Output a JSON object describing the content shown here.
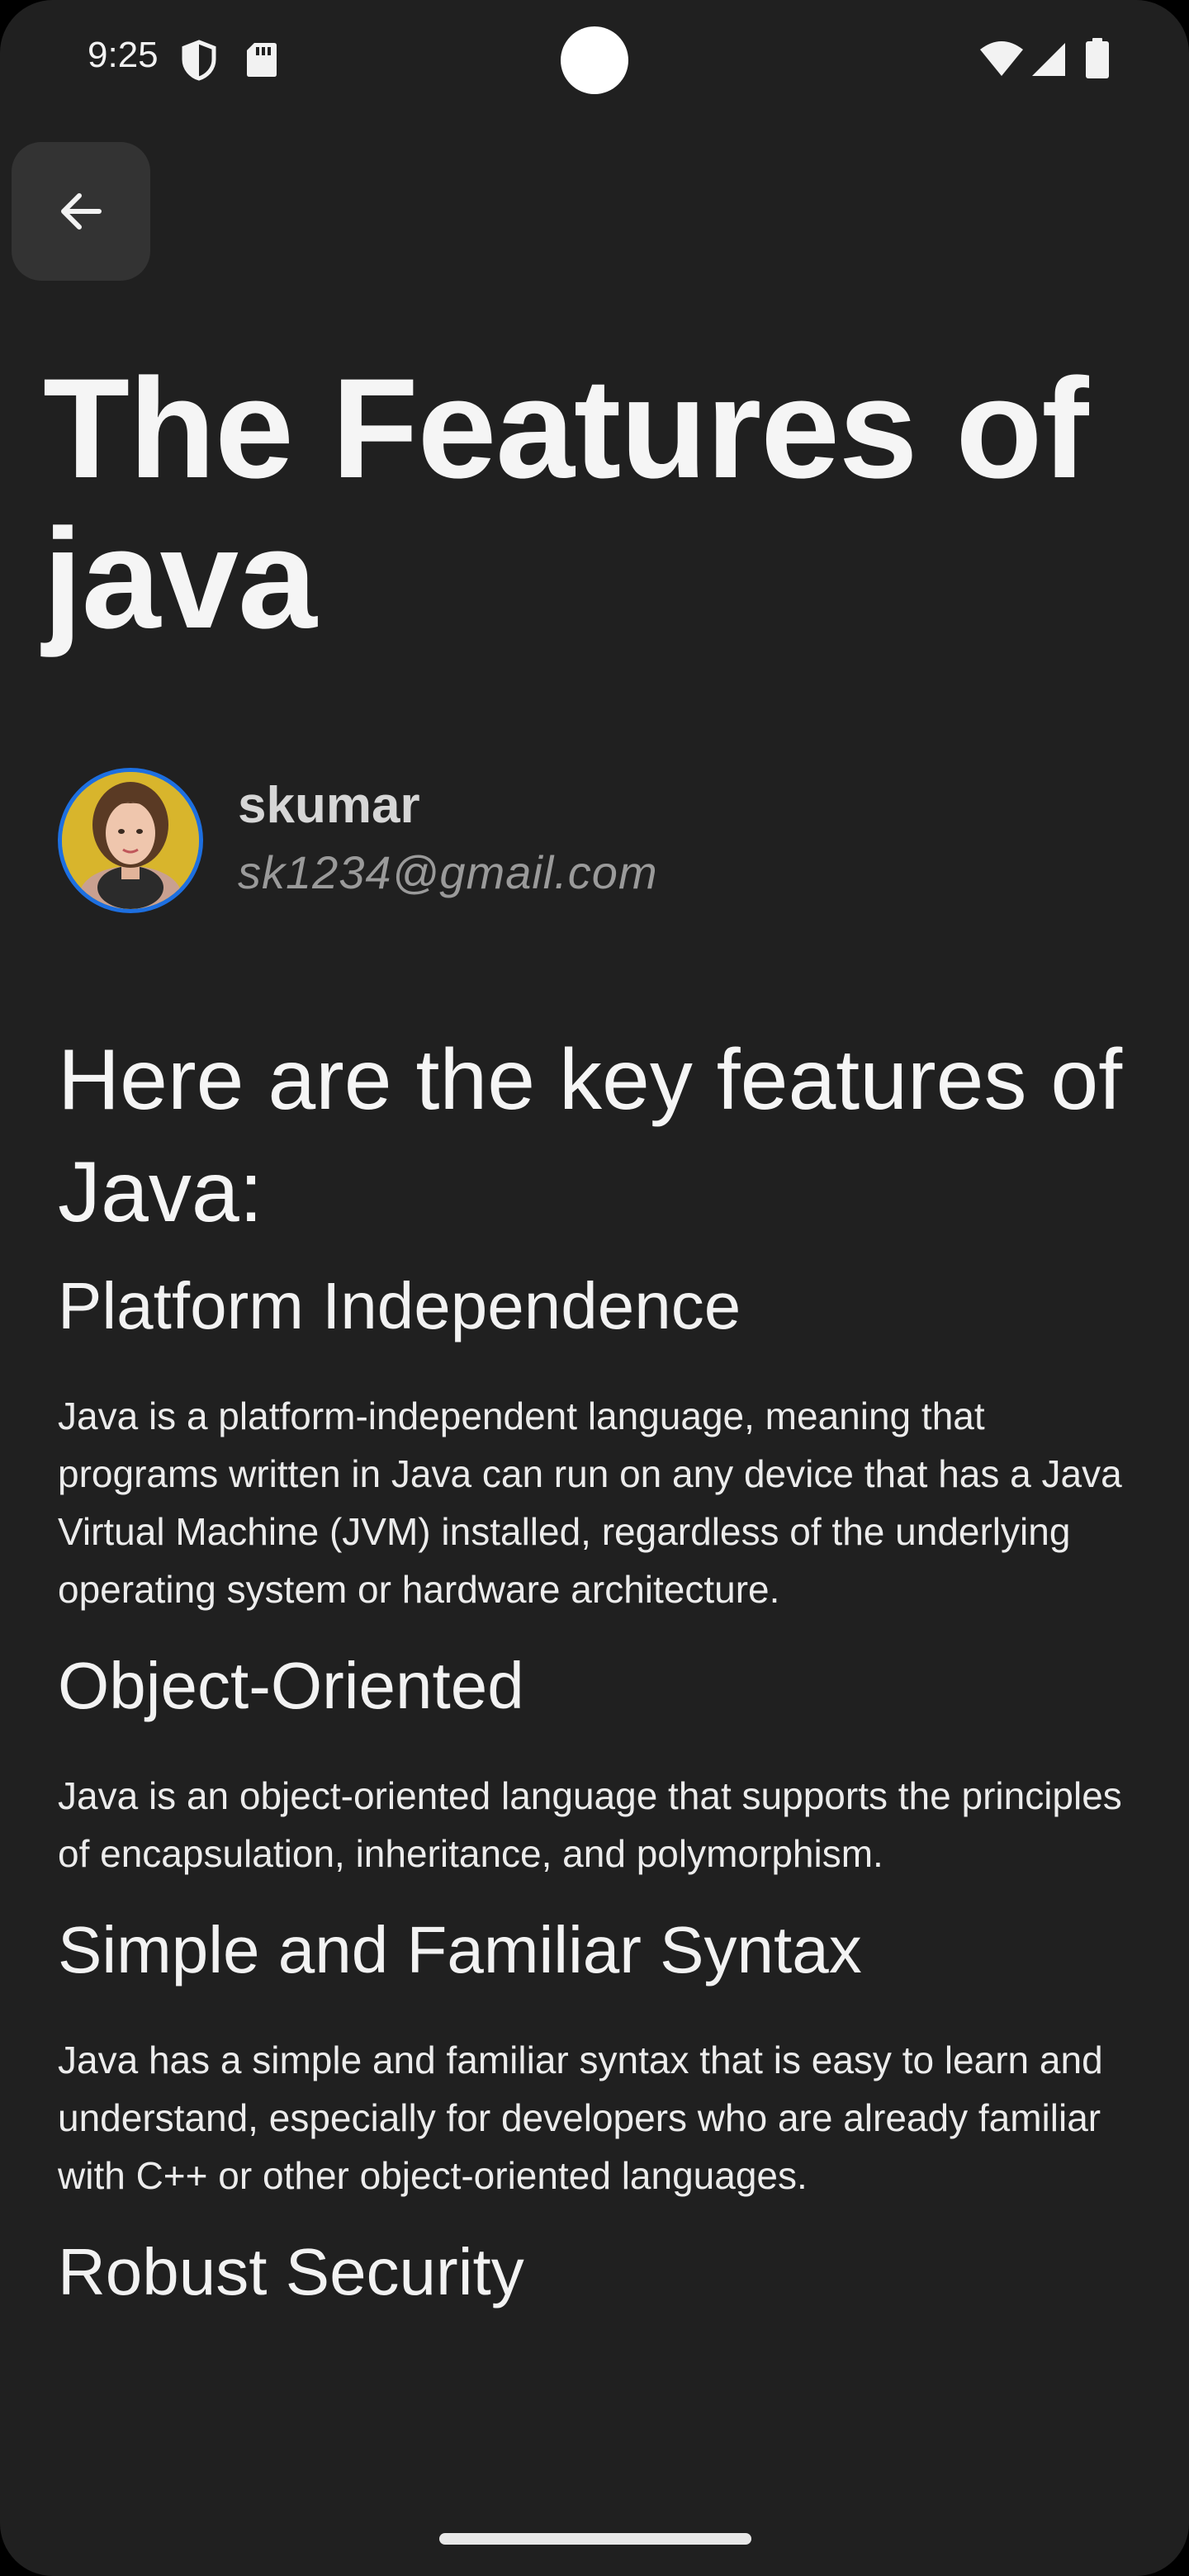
{
  "status_bar": {
    "time": "9:25",
    "icons": [
      "shield-icon",
      "sd-card-icon",
      "wifi-icon",
      "cell-signal-icon",
      "battery-icon"
    ]
  },
  "toolbar": {
    "back_icon": "arrow-back-icon"
  },
  "article": {
    "title": "The Features of java",
    "author": {
      "name": "skumar",
      "email": "sk1234@gmail.com",
      "avatar_border_color": "#1d6fe0"
    },
    "intro": "Here are the key features of Java:",
    "sections": [
      {
        "heading": "Platform Independence",
        "body": "Java is a platform-independent language, meaning that programs written in Java can run on any device that has a Java Virtual Machine (JVM) installed, regardless of the underlying operating system or hardware architecture."
      },
      {
        "heading": "Object-Oriented",
        "body": "Java is an object-oriented language that supports the principles of encapsulation, inheritance, and polymorphism."
      },
      {
        "heading": "Simple and Familiar Syntax",
        "body": "Java has a simple and familiar syntax that is easy to learn and understand, especially for developers who are already familiar with C++ or other object-oriented languages."
      },
      {
        "heading": "Robust Security",
        "body": ""
      }
    ]
  },
  "colors": {
    "background": "#202020",
    "back_button": "#333333",
    "text_primary": "#f5f5f5",
    "text_secondary": "#9a9a9a"
  }
}
